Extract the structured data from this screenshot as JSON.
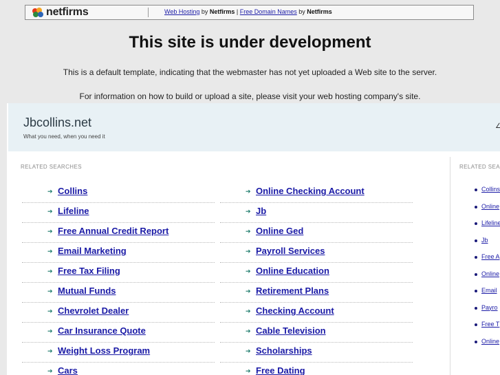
{
  "topbar": {
    "logo_text": "netfirms",
    "link1": "Web Hosting",
    "by1": " by ",
    "brand1": "Netfirms",
    "sep": " | ",
    "link2": "Free Domain Names",
    "by2": " by ",
    "brand2": "Netfirms"
  },
  "heading": "This site is under development",
  "message1": "This is a default template, indicating that the webmaster has not yet uploaded a Web site to the server.",
  "message2": "For information on how to build or upload a site, please visit your web hosting company's site.",
  "site": {
    "title": "Jbcollins.net",
    "tagline": "What you need, when you need it",
    "header_right_glyph": "∠"
  },
  "related_label": "RELATED SEARCHES",
  "related_label_side": "RELATED SEA",
  "arrow_glyph": "➔",
  "left_links": [
    "Collins",
    "Lifeline",
    "Free Annual Credit Report",
    "Email Marketing",
    "Free Tax Filing",
    "Mutual Funds",
    "Chevrolet Dealer",
    "Car Insurance Quote",
    "Weight Loss Program",
    "Cars"
  ],
  "right_links": [
    "Online Checking Account",
    "Jb",
    "Online Ged",
    "Payroll Services",
    "Online Education",
    "Retirement Plans",
    "Checking Account",
    "Cable Television",
    "Scholarships",
    "Free Dating"
  ],
  "side_links": [
    "Collins",
    "Online",
    "Lifeline",
    "Jb",
    "Free A",
    "Online",
    "Email",
    "Payro",
    "Free T",
    "Online"
  ]
}
